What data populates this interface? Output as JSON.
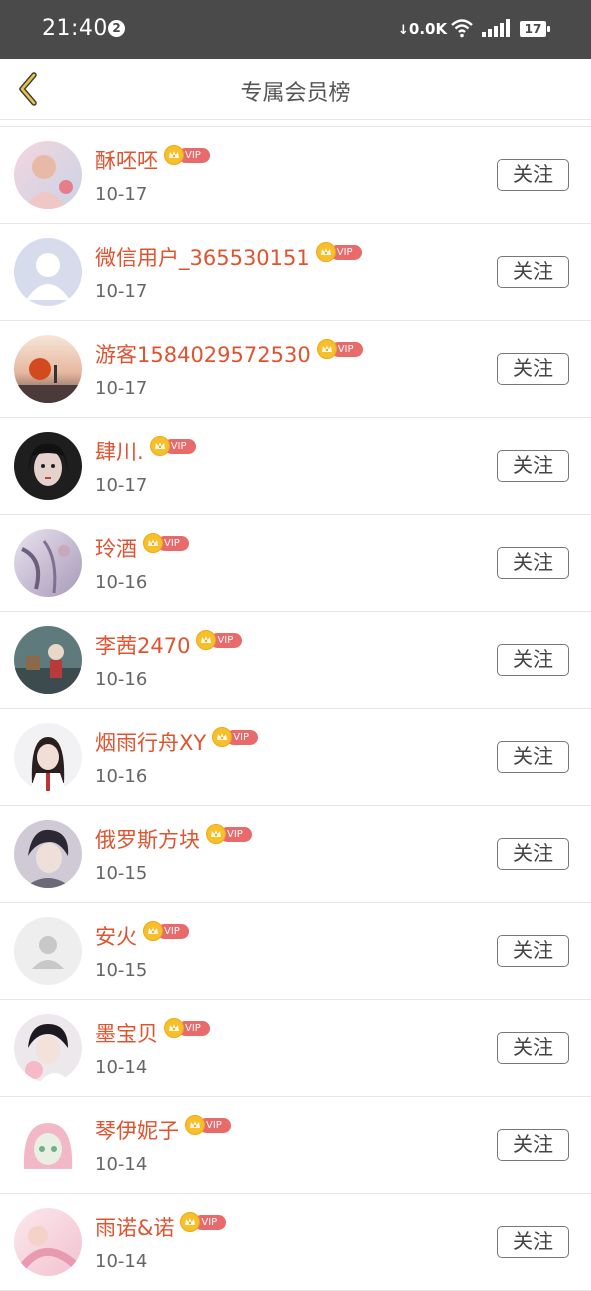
{
  "status_bar": {
    "time": "21:40",
    "notification_count": "2",
    "network_speed": "0.0K",
    "battery": "17"
  },
  "nav": {
    "title": "专属会员榜",
    "back_icon": "chevron-left-icon"
  },
  "colors": {
    "name": "#e0532f",
    "vip_pill": "#e86a6a",
    "crown": "#f5c02a",
    "status_bar": "#4a4a4a",
    "back_icon": "#c9a22a"
  },
  "vip_label": "VIP",
  "members": [
    {
      "name": "酥呸呸",
      "date": "10-17",
      "follow": "关注",
      "avatar": "photo-pink"
    },
    {
      "name": "微信用户_365530151",
      "date": "10-17",
      "follow": "关注",
      "avatar": "default-blue"
    },
    {
      "name": "游客1584029572530",
      "date": "10-17",
      "follow": "关注",
      "avatar": "photo-sunset"
    },
    {
      "name": "肆川.",
      "date": "10-17",
      "follow": "关注",
      "avatar": "photo-dark"
    },
    {
      "name": "玲酒",
      "date": "10-16",
      "follow": "关注",
      "avatar": "photo-purple"
    },
    {
      "name": "李茜2470",
      "date": "10-16",
      "follow": "关注",
      "avatar": "photo-teal"
    },
    {
      "name": "烟雨行舟XY",
      "date": "10-16",
      "follow": "关注",
      "avatar": "photo-portrait"
    },
    {
      "name": "俄罗斯方块",
      "date": "10-15",
      "follow": "关注",
      "avatar": "photo-boy"
    },
    {
      "name": "安火",
      "date": "10-15",
      "follow": "关注",
      "avatar": "default-gray"
    },
    {
      "name": "墨宝贝",
      "date": "10-14",
      "follow": "关注",
      "avatar": "photo-boy2"
    },
    {
      "name": "琴伊妮子",
      "date": "10-14",
      "follow": "关注",
      "avatar": "photo-anime"
    },
    {
      "name": "雨诺&诺",
      "date": "10-14",
      "follow": "关注",
      "avatar": "photo-pink2"
    }
  ]
}
